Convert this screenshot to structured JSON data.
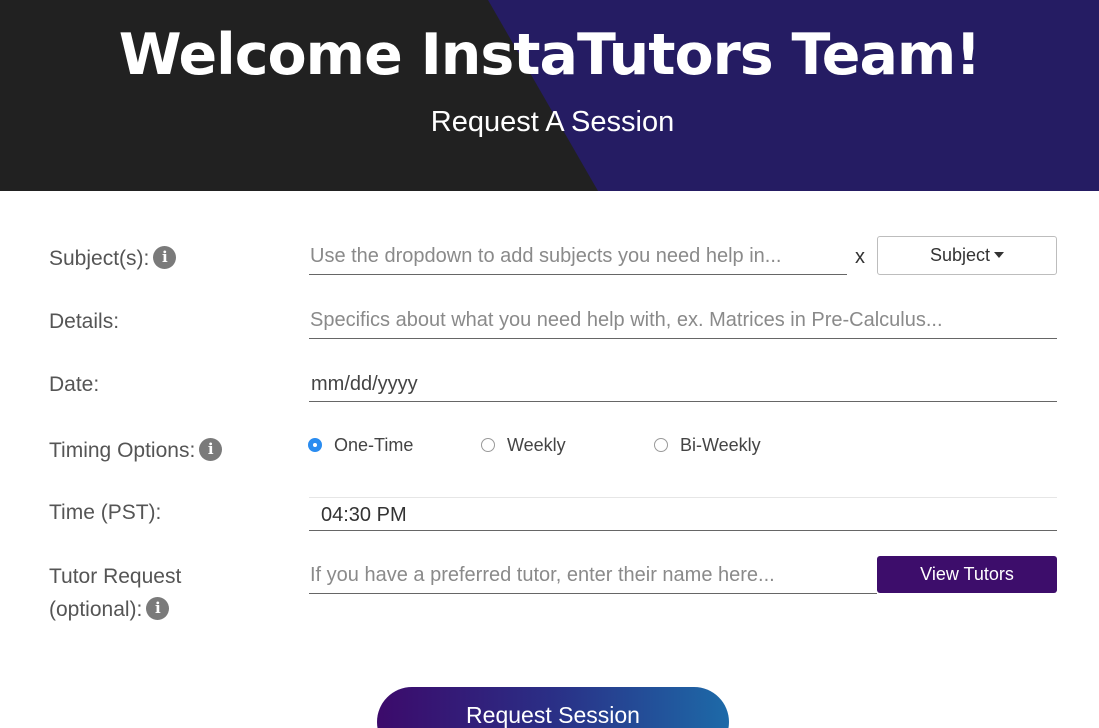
{
  "header": {
    "title": "Welcome InstaTutors Team!",
    "subtitle": "Request A Session",
    "colors": {
      "dark": "#212121",
      "navy": "#251c63"
    }
  },
  "form": {
    "subjects": {
      "label": "Subject(s):",
      "placeholder": "Use the dropdown to add subjects you need help in...",
      "clear": "x",
      "dropdown_label": "Subject"
    },
    "details": {
      "label": "Details:",
      "placeholder": "Specifics about what you need help with, ex. Matrices in Pre-Calculus..."
    },
    "date": {
      "label": "Date:",
      "value": "mm/dd/yyyy"
    },
    "timing": {
      "label": "Timing Options:",
      "options": [
        "One-Time",
        "Weekly",
        "Bi-Weekly"
      ],
      "selected": "One-Time"
    },
    "time": {
      "label": "Time (PST):",
      "value": "04:30 PM"
    },
    "tutor": {
      "label_line1": "Tutor Request",
      "label_line2": "(optional):",
      "placeholder": "If you have a preferred tutor, enter their name here...",
      "button": "View Tutors"
    },
    "submit": "Request Session"
  },
  "icons": {
    "info": "info-circle-icon",
    "caret": "caret-down-icon"
  },
  "accent": {
    "primary": "#3d0d6b",
    "radio": "#2a8cf0"
  }
}
